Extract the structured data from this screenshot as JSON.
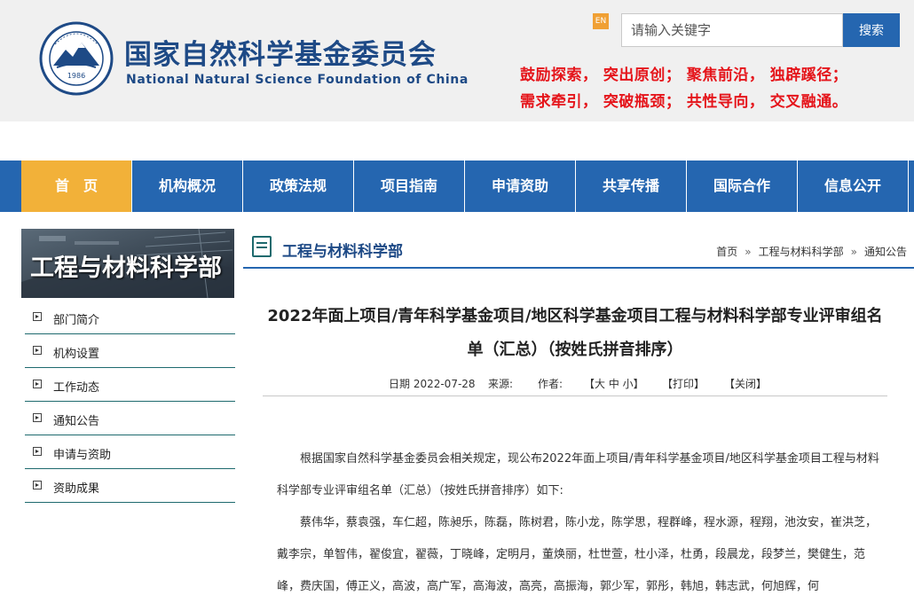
{
  "header": {
    "emblem_year": "1986",
    "logo_cn": "国家自然科学基金委员会",
    "logo_en": "National Natural Science Foundation of China",
    "en_badge": "EN",
    "search_placeholder": "请输入关键字",
    "search_button": "搜索",
    "slogan_line1": "鼓励探索， 突出原创； 聚焦前沿， 独辟蹊径；",
    "slogan_line2": "需求牵引， 突破瓶颈； 共性导向， 交叉融通。"
  },
  "nav": {
    "items": [
      {
        "label": "首　页"
      },
      {
        "label": "机构概况"
      },
      {
        "label": "政策法规"
      },
      {
        "label": "项目指南"
      },
      {
        "label": "申请资助"
      },
      {
        "label": "共享传播"
      },
      {
        "label": "国际合作"
      },
      {
        "label": "信息公开"
      }
    ]
  },
  "sidebar": {
    "banner_title": "工程与材料科学部",
    "items": [
      {
        "label": "部门简介"
      },
      {
        "label": "机构设置"
      },
      {
        "label": "工作动态"
      },
      {
        "label": "通知公告"
      },
      {
        "label": "申请与资助"
      },
      {
        "label": "资助成果"
      }
    ]
  },
  "section": {
    "title": "工程与材料科学部",
    "breadcrumb": [
      "首页",
      "工程与材料科学部",
      "通知公告"
    ],
    "breadcrumb_sep": "»"
  },
  "article": {
    "title": "2022年面上项目/青年科学基金项目/地区科学基金项目工程与材料科学部专业评审组名单（汇总）（按姓氏拼音排序）",
    "date": "日期 2022-07-28",
    "source": "来源:",
    "author": "作者:",
    "font_size_ctrl": "【大 中 小】",
    "print": "【打印】",
    "close": "【关闭】",
    "paragraph1": "根据国家自然科学基金委员会相关规定，现公布2022年面上项目/青年科学基金项目/地区科学基金项目工程与材料科学部专业评审组名单（汇总）（按姓氏拼音排序）如下:",
    "paragraph2": "蔡伟华，蔡袁强，车仁超，陈昶乐，陈磊，陈树君，陈小龙，陈学思，程群峰，程水源，程翔，池汝安，崔洪芝，戴李宗，单智伟，翟俊宜，翟薇，丁晓峰，定明月，董焕丽，杜世萱，杜小泽，杜勇，段晨龙，段梦兰，樊健生，范峰，费庆国，傅正义，高波，高广军，高海波，高亮，高振海，郭少军，郭彤，韩旭，韩志武，何旭辉，何"
  }
}
